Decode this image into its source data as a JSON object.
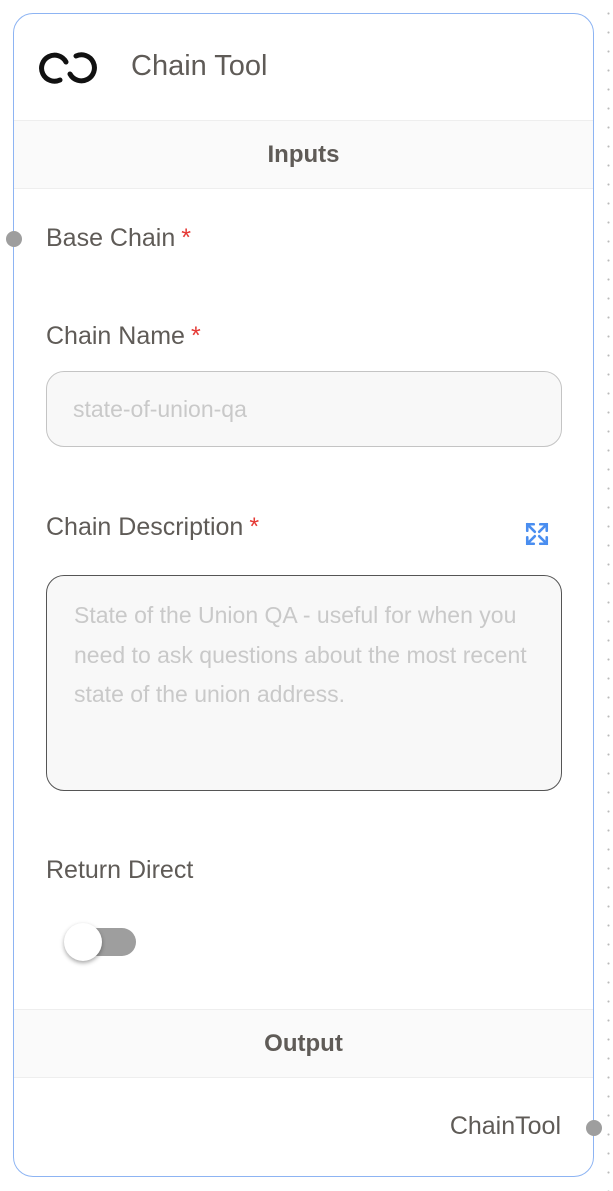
{
  "node": {
    "title": "Chain Tool",
    "icon": "chain-link-icon",
    "inputs_heading": "Inputs",
    "output_heading": "Output",
    "fields": {
      "base_chain": {
        "label": "Base Chain",
        "required": "*"
      },
      "chain_name": {
        "label": "Chain Name",
        "required": "*",
        "placeholder": "state-of-union-qa"
      },
      "chain_description": {
        "label": "Chain Description",
        "required": "*",
        "placeholder": "State of the Union QA - useful for when you need to ask questions about the most recent state of the union address."
      },
      "return_direct": {
        "label": "Return Direct",
        "value": false
      }
    },
    "output": {
      "label": "ChainTool"
    }
  },
  "colors": {
    "accent": "#4a8ef0",
    "required": "#e53935",
    "border": "#8db4f3"
  }
}
